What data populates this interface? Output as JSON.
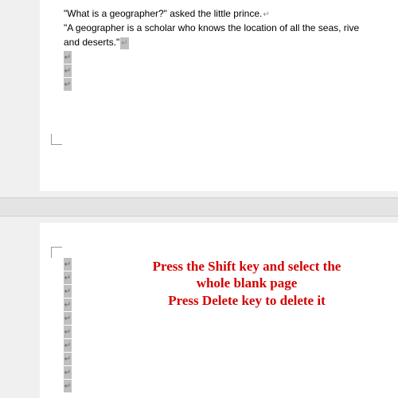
{
  "document": {
    "line1": "\"What is a geographer?\" asked the little prince.",
    "line2": "\"A geographer is a scholar who knows the location of all the seas, rive",
    "line3": "and deserts.\"",
    "para_symbol": "↵"
  },
  "instruction": {
    "line1": "Press the Shift key and select the",
    "line2": "whole blank page",
    "line3": "Press Delete key to delete it"
  }
}
